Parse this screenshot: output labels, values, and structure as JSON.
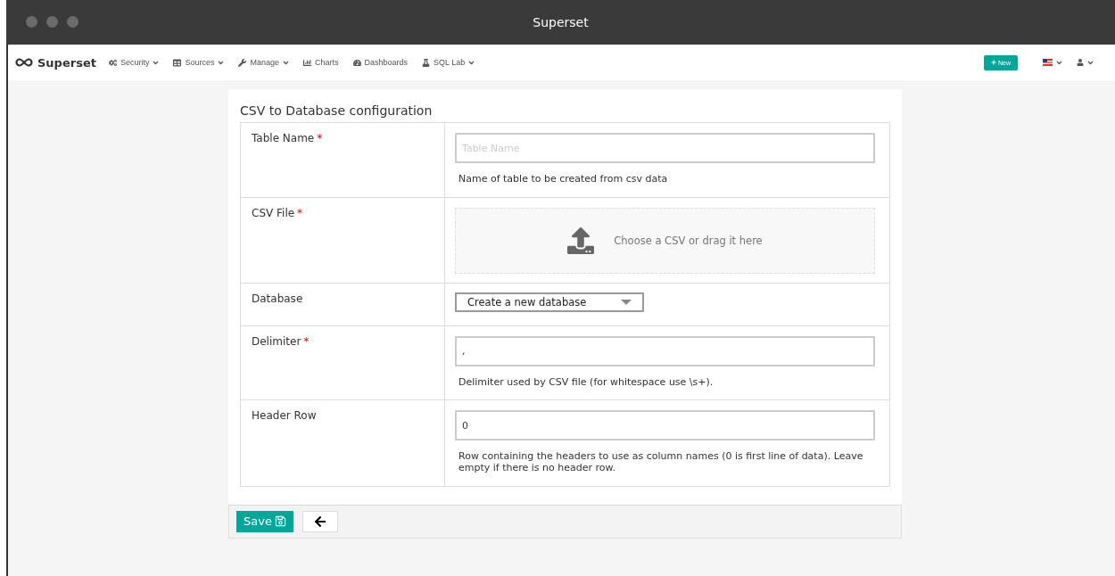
{
  "window": {
    "title": "Superset"
  },
  "navbar": {
    "brand": "Superset",
    "items": [
      {
        "label": "Security",
        "has_caret": true
      },
      {
        "label": "Sources",
        "has_caret": true
      },
      {
        "label": "Manage",
        "has_caret": true
      },
      {
        "label": "Charts",
        "has_caret": false
      },
      {
        "label": "Dashboards",
        "has_caret": false
      },
      {
        "label": "SQL Lab",
        "has_caret": true
      }
    ],
    "new_button": "New"
  },
  "form": {
    "title": "CSV to Database configuration",
    "fields": [
      {
        "kind": "text",
        "label": "Table Name",
        "required_mark": "*",
        "placeholder": "Table Name",
        "help": "Name of table to be created from csv data"
      },
      {
        "kind": "file",
        "label": "CSV File",
        "required_mark": "*",
        "prompt": "Choose a CSV or drag it here"
      },
      {
        "kind": "select",
        "label": "Database",
        "value": "Create a new database"
      },
      {
        "kind": "text",
        "label": "Delimiter",
        "required_mark": "*",
        "value": ",",
        "help": "Delimiter used by CSV file (for whitespace use \\s+)."
      },
      {
        "kind": "text",
        "label": "Header Row",
        "value": "0",
        "help": "Row containing the headers to use as column names (0 is first line of data). Leave empty if there is no header row."
      }
    ],
    "save_button": "Save"
  }
}
